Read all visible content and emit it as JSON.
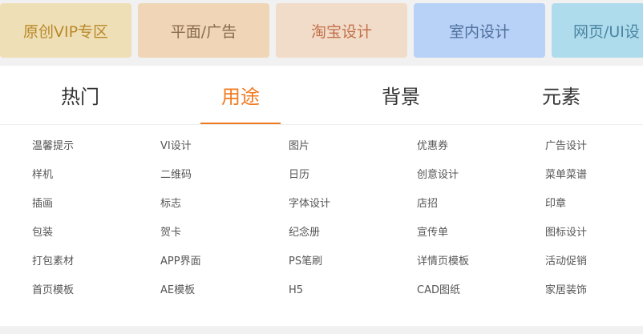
{
  "categories": [
    {
      "label": "原创VIP专区"
    },
    {
      "label": "平面/广告"
    },
    {
      "label": "淘宝设计"
    },
    {
      "label": "室内设计"
    },
    {
      "label": "网页/UI设"
    }
  ],
  "tabs": [
    {
      "label": "热门"
    },
    {
      "label": "用途"
    },
    {
      "label": "背景"
    },
    {
      "label": "元素"
    }
  ],
  "active_tab": "用途",
  "accent_color": "#f07b22",
  "grid": [
    [
      "温馨提示",
      "VI设计",
      "图片",
      "优惠券",
      "广告设计"
    ],
    [
      "样机",
      "二维码",
      "日历",
      "创意设计",
      "菜单菜谱"
    ],
    [
      "插画",
      "标志",
      "字体设计",
      "店招",
      "印章"
    ],
    [
      "包装",
      "贺卡",
      "纪念册",
      "宣传单",
      "图标设计"
    ],
    [
      "打包素材",
      "APP界面",
      "PS笔刷",
      "详情页模板",
      "活动促销"
    ],
    [
      "首页模板",
      "AE模板",
      "H5",
      "CAD图纸",
      "家居装饰"
    ]
  ]
}
